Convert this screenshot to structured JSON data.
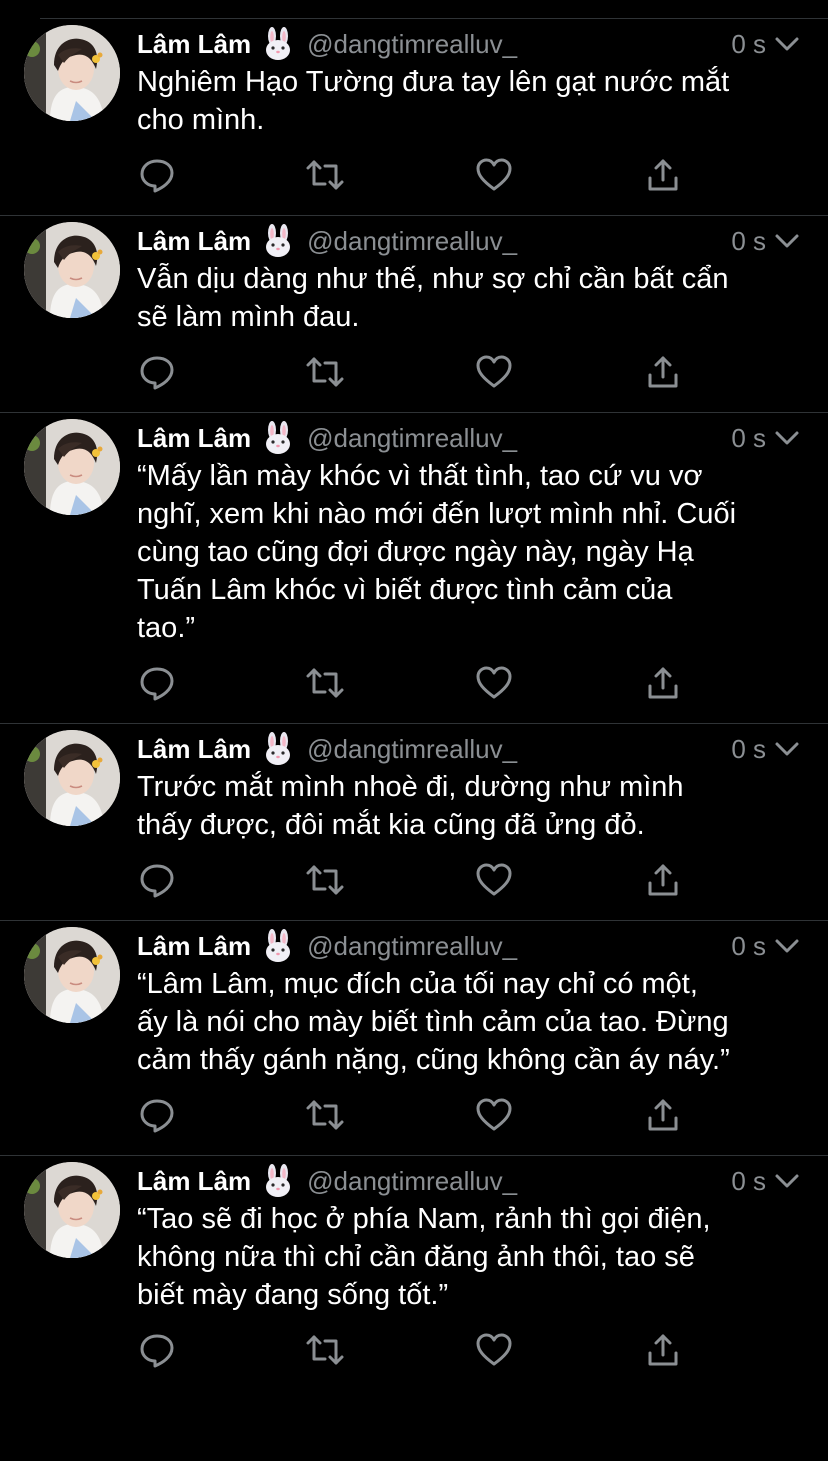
{
  "colors": {
    "background": "#000000",
    "text": "#ffffff",
    "secondary": "#8b8f93",
    "divider": "#2f3336"
  },
  "icons": {
    "reply": "reply-icon",
    "retweet": "retweet-icon",
    "like": "heart-icon",
    "share": "share-icon",
    "more": "chevron-down-icon",
    "emoji": "rabbit-face-emoji"
  },
  "tweets": [
    {
      "author": {
        "name": "Lâm Lâm",
        "handle": "@dangtimrealluv_"
      },
      "time": "0 s",
      "text": "Nghiêm Hạo Tường đưa tay lên gạt nước mắt\ncho mình."
    },
    {
      "author": {
        "name": "Lâm Lâm",
        "handle": "@dangtimrealluv_"
      },
      "time": "0 s",
      "text": "Vẫn dịu dàng như thế, như sợ chỉ cần bất cẩn\nsẽ làm mình đau."
    },
    {
      "author": {
        "name": "Lâm Lâm",
        "handle": "@dangtimrealluv_"
      },
      "time": "0 s",
      "text": "“Mấy lần mày khóc vì thất tình, tao cứ vu vơ\nnghĩ, xem khi nào mới đến lượt mình nhỉ. Cuối\ncùng tao cũng đợi được ngày này, ngày Hạ\nTuấn Lâm khóc vì biết được tình cảm của\ntao.”"
    },
    {
      "author": {
        "name": "Lâm Lâm",
        "handle": "@dangtimrealluv_"
      },
      "time": "0 s",
      "text": "Trước mắt mình nhoè đi, dường như mình\nthấy được, đôi mắt kia cũng đã ửng đỏ."
    },
    {
      "author": {
        "name": "Lâm Lâm",
        "handle": "@dangtimrealluv_"
      },
      "time": "0 s",
      "text": "“Lâm Lâm, mục đích của tối nay chỉ có một,\nấy là nói cho mày biết tình cảm của tao. Đừng\ncảm thấy gánh nặng, cũng không cần áy náy.”"
    },
    {
      "author": {
        "name": "Lâm Lâm",
        "handle": "@dangtimrealluv_"
      },
      "time": "0 s",
      "text": "“Tao sẽ đi học ở phía Nam, rảnh thì gọi điện,\nkhông nữa thì chỉ cần đăng ảnh thôi, tao sẽ\nbiết mày đang sống tốt.”"
    }
  ]
}
